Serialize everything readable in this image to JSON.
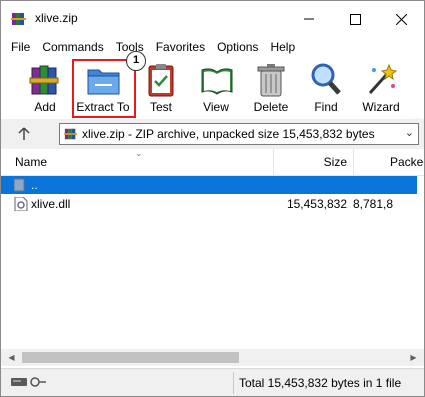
{
  "window": {
    "title": "xlive.zip"
  },
  "menu": [
    "File",
    "Commands",
    "Tools",
    "Favorites",
    "Options",
    "Help"
  ],
  "toolbar": {
    "buttons": [
      {
        "label": "Add",
        "icon": "add-books-icon"
      },
      {
        "label": "Extract To",
        "icon": "folder-extract-icon"
      },
      {
        "label": "Test",
        "icon": "clipboard-check-icon"
      },
      {
        "label": "View",
        "icon": "open-book-icon"
      },
      {
        "label": "Delete",
        "icon": "trash-can-icon"
      },
      {
        "label": "Find",
        "icon": "magnifier-icon"
      },
      {
        "label": "Wizard",
        "icon": "magic-wand-icon"
      }
    ],
    "callout": "1",
    "highlight_color": "#e8191e"
  },
  "address": {
    "text": "xlive.zip - ZIP archive, unpacked size 15,453,832 bytes"
  },
  "list": {
    "columns": {
      "name": "Name",
      "size": "Size",
      "packed": "Packed"
    },
    "rows": [
      {
        "name": "..",
        "size": "",
        "packed": "",
        "selected": true
      },
      {
        "name": "xlive.dll",
        "size": "15,453,832",
        "packed": "8,781,8",
        "selected": false
      }
    ],
    "selection_color": "#0a74d9"
  },
  "status": {
    "text": "Total 15,453,832 bytes in 1 file"
  }
}
